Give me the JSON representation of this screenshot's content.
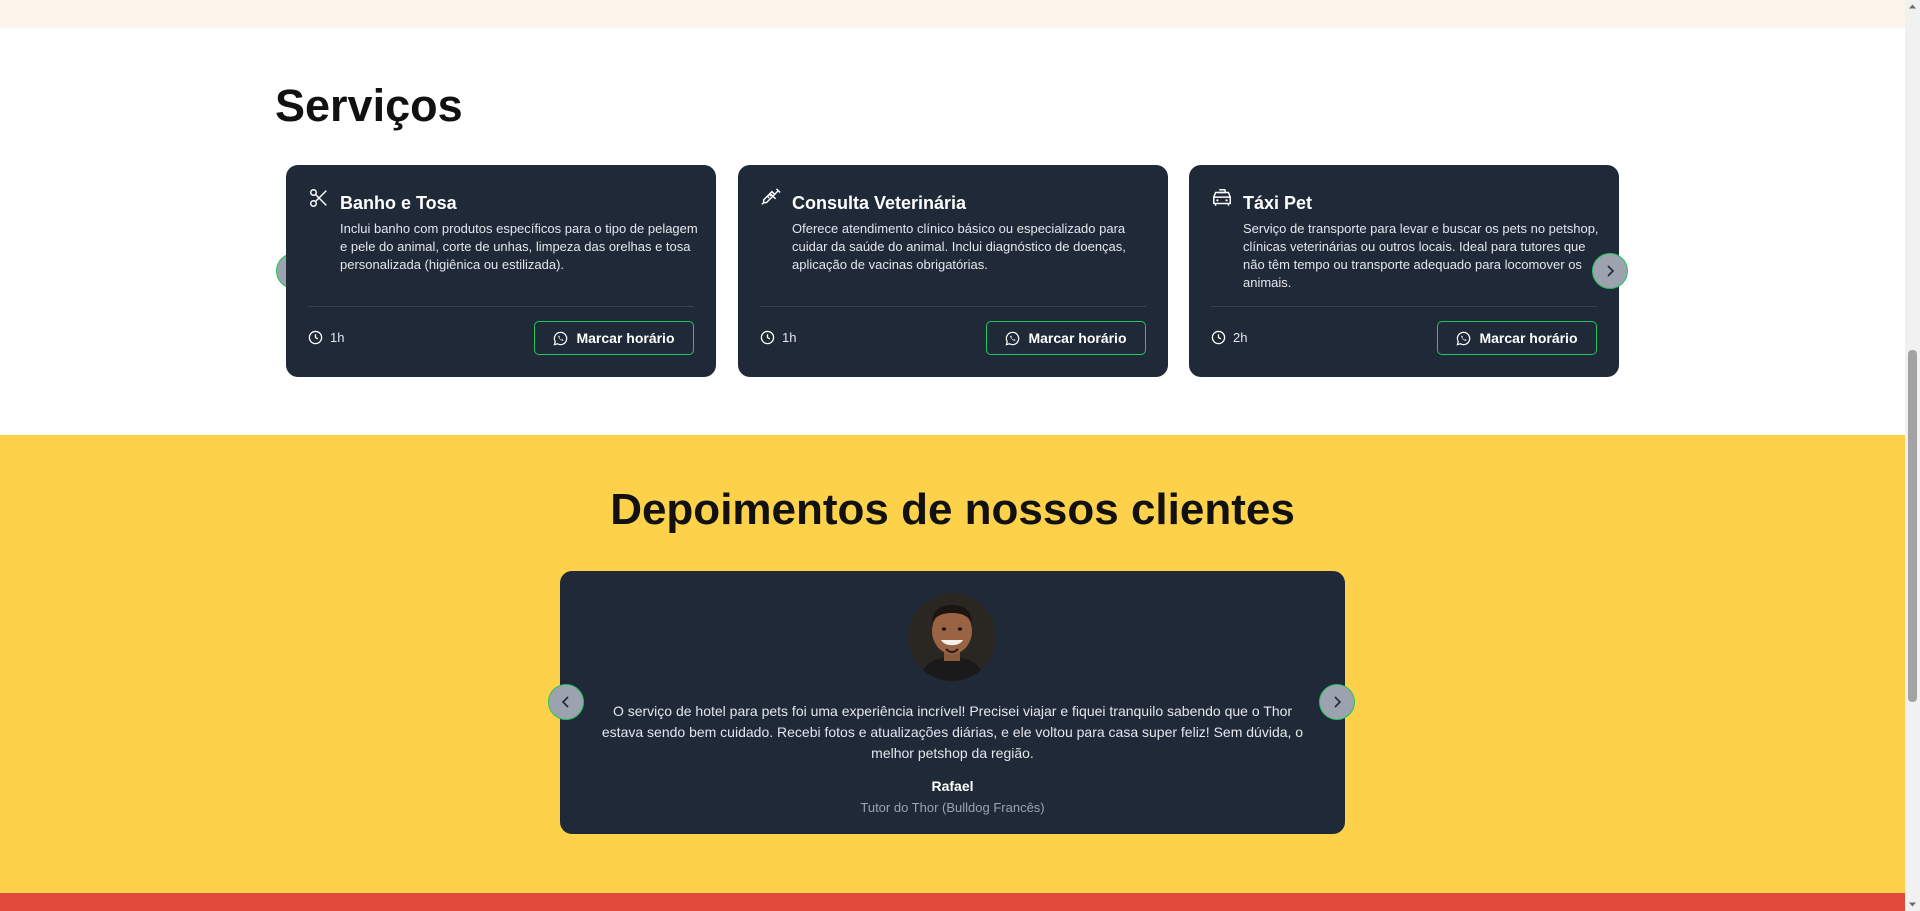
{
  "services": {
    "heading": "Serviços",
    "book_label": "Marcar horário",
    "cards": [
      {
        "icon": "scissors-icon",
        "title": "Banho e Tosa",
        "description": "Inclui banho com produtos específicos para o tipo de pelagem e pele do animal, corte de unhas, limpeza das orelhas e tosa personalizada (higiênica ou estilizada).",
        "duration": "1h"
      },
      {
        "icon": "syringe-icon",
        "title": "Consulta Veterinária",
        "description": "Oferece atendimento clínico básico ou especializado para cuidar da saúde do animal. Inclui diagnóstico de doenças, aplicação de vacinas obrigatórias.",
        "duration": "1h"
      },
      {
        "icon": "taxi-icon",
        "title": "Táxi Pet",
        "description": "Serviço de transporte para levar e buscar os pets no petshop, clínicas veterinárias ou outros locais. Ideal para tutores que não têm tempo ou transporte adequado para locomover os animais.",
        "duration": "2h"
      }
    ]
  },
  "testimonials": {
    "heading": "Depoimentos de nossos clientes",
    "quote": "O serviço de hotel para pets foi uma experiência incrível! Precisei viajar e fiquei tranquilo sabendo que o Thor estava sendo bem cuidado. Recebi fotos e atualizações diárias, e ele voltou para casa super feliz! Sem dúvida, o melhor petshop da região.",
    "name": "Rafael",
    "role": "Tutor do Thor (Bulldog Francês)"
  },
  "colors": {
    "card_bg": "#1f2937",
    "accent_green": "#22c55e",
    "testimonials_bg": "#fdd24a",
    "footer_red": "#e24a3b"
  }
}
